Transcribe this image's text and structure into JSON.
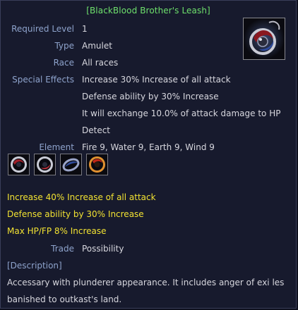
{
  "item": {
    "name": "[BlackBlood Brother's Leash]",
    "icon": "amulet-icon",
    "required_level_label": "Required Level",
    "required_level_value": "1",
    "type_label": "Type",
    "type_value": "Amulet",
    "race_label": "Race",
    "race_value": "All races",
    "special_effects_label": "Special Effects",
    "special_effects": [
      "Increase 30% Increase of all attack",
      "Defense ability by 30% Increase",
      "It will exchange 10.0% of attack damage to HP",
      "Detect"
    ],
    "element_label": "Element",
    "element_value": "Fire 9, Water 9, Earth 9, Wind 9",
    "element_slots": [
      "fire-orb-icon",
      "water-orb-icon",
      "earth-orb-icon",
      "wind-orb-icon"
    ],
    "bonus_lines": [
      "Increase 40% Increase of all attack",
      "Defense ability by 30% Increase",
      "Max HP/FP 8% Increase"
    ],
    "trade_label": "Trade",
    "trade_value": "Possibility",
    "description_header": "[Description]",
    "description": "Accessary with plunderer appearance. It includes anger of exi les banished to outkast's land."
  },
  "colors": {
    "title": "#6ee06c",
    "label": "#8ea3cc",
    "value": "#d7d7de",
    "bonus": "#f2e232",
    "background": "#171a2d"
  }
}
